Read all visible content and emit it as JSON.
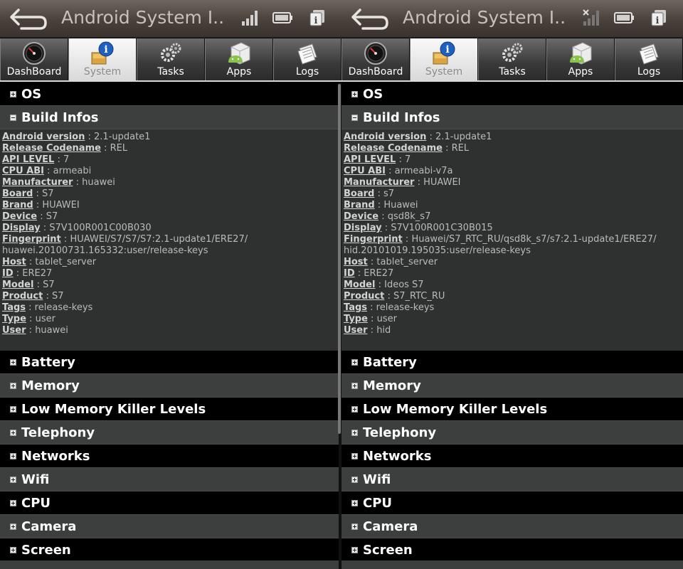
{
  "colors": {
    "accent_green": "#8bc34a",
    "text_light": "#c6c1bb",
    "tab_active": "#e8e8e8"
  },
  "panes": [
    {
      "title": "Android System I...",
      "tabs": [
        {
          "label": "DashBoard",
          "icon": "dashboard-gauge-icon"
        },
        {
          "label": "System",
          "icon": "system-info-icon",
          "active": true
        },
        {
          "label": "Tasks",
          "icon": "gears-icon"
        },
        {
          "label": "Apps",
          "icon": "android-apps-icon"
        },
        {
          "label": "Logs",
          "icon": "logs-icon"
        }
      ],
      "sections_top": [
        {
          "label": "OS",
          "expanded": false
        },
        {
          "label": "Build Infos",
          "expanded": true
        }
      ],
      "build_infos": [
        {
          "key": "Android version",
          "value": "2.1-update1"
        },
        {
          "key": "Release Codename",
          "value": "REL"
        },
        {
          "key": "API LEVEL",
          "value": "7"
        },
        {
          "key": "CPU ABI",
          "value": "armeabi"
        },
        {
          "key": "Manufacturer",
          "value": "huawei"
        },
        {
          "key": "Board",
          "value": "S7"
        },
        {
          "key": "Brand",
          "value": "HUAWEI"
        },
        {
          "key": "Device",
          "value": "S7"
        },
        {
          "key": "Display",
          "value": "S7V100R001C00B030"
        },
        {
          "key": "Fingerprint",
          "value": "HUAWEI/S7/S7/S7:2.1-update1/ERE27/",
          "continuation": "huawei.20100731.165332:user/release-keys"
        },
        {
          "key": "Host",
          "value": "tablet_server"
        },
        {
          "key": "ID",
          "value": "ERE27"
        },
        {
          "key": "Model",
          "value": "S7"
        },
        {
          "key": "Product",
          "value": "S7"
        },
        {
          "key": "Tags",
          "value": "release-keys"
        },
        {
          "key": "Type",
          "value": "user"
        },
        {
          "key": "User",
          "value": "huawei"
        }
      ],
      "sections_bottom": [
        "Battery",
        "Memory",
        "Low Memory Killer Levels",
        "Telephony",
        "Networks",
        "Wifi",
        "CPU",
        "Camera",
        "Screen"
      ]
    },
    {
      "title": "Android System I...",
      "tabs": [
        {
          "label": "DashBoard",
          "icon": "dashboard-gauge-icon"
        },
        {
          "label": "System",
          "icon": "system-info-icon",
          "active": true
        },
        {
          "label": "Tasks",
          "icon": "gears-icon"
        },
        {
          "label": "Apps",
          "icon": "android-apps-icon"
        },
        {
          "label": "Logs",
          "icon": "logs-icon"
        }
      ],
      "sections_top": [
        {
          "label": "OS",
          "expanded": false
        },
        {
          "label": "Build Infos",
          "expanded": true
        }
      ],
      "build_infos": [
        {
          "key": "Android version",
          "value": "2.1-update1"
        },
        {
          "key": "Release Codename",
          "value": "REL"
        },
        {
          "key": "API LEVEL",
          "value": "7"
        },
        {
          "key": "CPU ABI",
          "value": "armeabi-v7a"
        },
        {
          "key": "Manufacturer",
          "value": "HUAWEI"
        },
        {
          "key": "Board",
          "value": "s7"
        },
        {
          "key": "Brand",
          "value": "Huawei"
        },
        {
          "key": "Device",
          "value": "qsd8k_s7"
        },
        {
          "key": "Display",
          "value": "S7V100R001C30B015"
        },
        {
          "key": "Fingerprint",
          "value": "Huawei/S7_RTC_RU/qsd8k_s7/s7:2.1-update1/ERE27/",
          "continuation": "hid.20101019.195035:user/release-keys"
        },
        {
          "key": "Host",
          "value": "tablet_server"
        },
        {
          "key": "ID",
          "value": "ERE27"
        },
        {
          "key": "Model",
          "value": "Ideos S7"
        },
        {
          "key": "Product",
          "value": "S7_RTC_RU"
        },
        {
          "key": "Tags",
          "value": "release-keys"
        },
        {
          "key": "Type",
          "value": "user"
        },
        {
          "key": "User",
          "value": "hid"
        }
      ],
      "sections_bottom": [
        "Battery",
        "Memory",
        "Low Memory Killer Levels",
        "Telephony",
        "Networks",
        "Wifi",
        "CPU",
        "Camera",
        "Screen"
      ]
    }
  ]
}
